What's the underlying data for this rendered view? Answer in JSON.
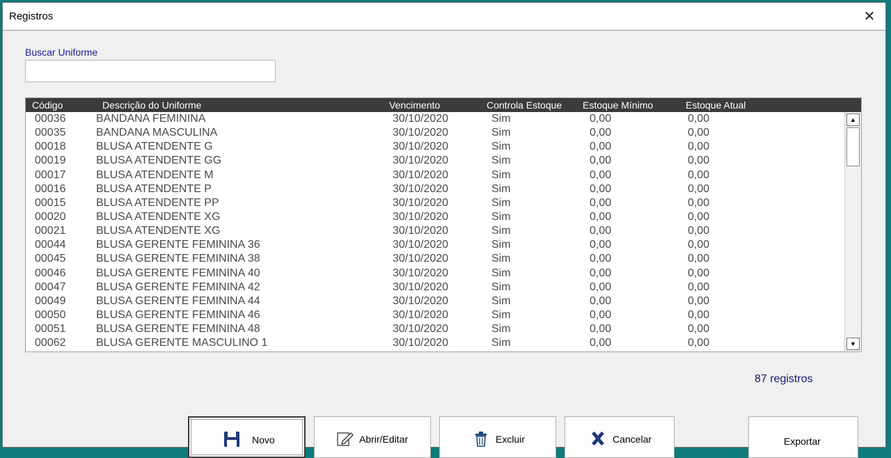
{
  "window": {
    "title": "Registros"
  },
  "search": {
    "label": "Buscar Uniforme",
    "value": "",
    "placeholder": ""
  },
  "grid": {
    "columns": [
      "Código",
      "Descrição do Uniforme",
      "Vencimento",
      "Controla Estoque",
      "Estoque Mínimo",
      "Estoque Atual"
    ],
    "rows": [
      [
        "00036",
        "BANDANA FEMININA",
        "30/10/2020",
        "Sim",
        "0,00",
        "0,00"
      ],
      [
        "00035",
        "BANDANA MASCULINA",
        "30/10/2020",
        "Sim",
        "0,00",
        "0,00"
      ],
      [
        "00018",
        "BLUSA ATENDENTE G",
        "30/10/2020",
        "Sim",
        "0,00",
        "0,00"
      ],
      [
        "00019",
        "BLUSA ATENDENTE GG",
        "30/10/2020",
        "Sim",
        "0,00",
        "0,00"
      ],
      [
        "00017",
        "BLUSA ATENDENTE M",
        "30/10/2020",
        "Sim",
        "0,00",
        "0,00"
      ],
      [
        "00016",
        "BLUSA ATENDENTE P",
        "30/10/2020",
        "Sim",
        "0,00",
        "0,00"
      ],
      [
        "00015",
        "BLUSA ATENDENTE PP",
        "30/10/2020",
        "Sim",
        "0,00",
        "0,00"
      ],
      [
        "00020",
        "BLUSA ATENDENTE XG",
        "30/10/2020",
        "Sim",
        "0,00",
        "0,00"
      ],
      [
        "00021",
        "BLUSA ATENDENTE XG",
        "30/10/2020",
        "Sim",
        "0,00",
        "0,00"
      ],
      [
        "00044",
        "BLUSA GERENTE FEMININA 36",
        "30/10/2020",
        "Sim",
        "0,00",
        "0,00"
      ],
      [
        "00045",
        "BLUSA GERENTE FEMININA 38",
        "30/10/2020",
        "Sim",
        "0,00",
        "0,00"
      ],
      [
        "00046",
        "BLUSA GERENTE FEMININA 40",
        "30/10/2020",
        "Sim",
        "0,00",
        "0,00"
      ],
      [
        "00047",
        "BLUSA GERENTE FEMININA 42",
        "30/10/2020",
        "Sim",
        "0,00",
        "0,00"
      ],
      [
        "00049",
        "BLUSA GERENTE FEMININA 44",
        "30/10/2020",
        "Sim",
        "0,00",
        "0,00"
      ],
      [
        "00050",
        "BLUSA GERENTE FEMININA 46",
        "30/10/2020",
        "Sim",
        "0,00",
        "0,00"
      ],
      [
        "00051",
        "BLUSA GERENTE FEMININA 48",
        "30/10/2020",
        "Sim",
        "0,00",
        "0,00"
      ],
      [
        "00062",
        "BLUSA GERENTE MASCULINO 1",
        "30/10/2020",
        "Sim",
        "0,00",
        "0,00"
      ]
    ]
  },
  "footer": {
    "count": "87 registros"
  },
  "buttons": {
    "novo": {
      "label": "Novo",
      "icon": "save-icon"
    },
    "abrir": {
      "label": "Abrir/Editar",
      "icon": "edit-icon"
    },
    "excluir": {
      "label": "Excluir",
      "icon": "trash-icon"
    },
    "cancelar": {
      "label": "Cancelar",
      "icon": "x-icon"
    },
    "exportar": {
      "label": "Exportar"
    }
  },
  "colors": {
    "accent": "#1a1a9c",
    "header_bg": "#3b3b3b",
    "desktop": "#0f7b7b"
  }
}
